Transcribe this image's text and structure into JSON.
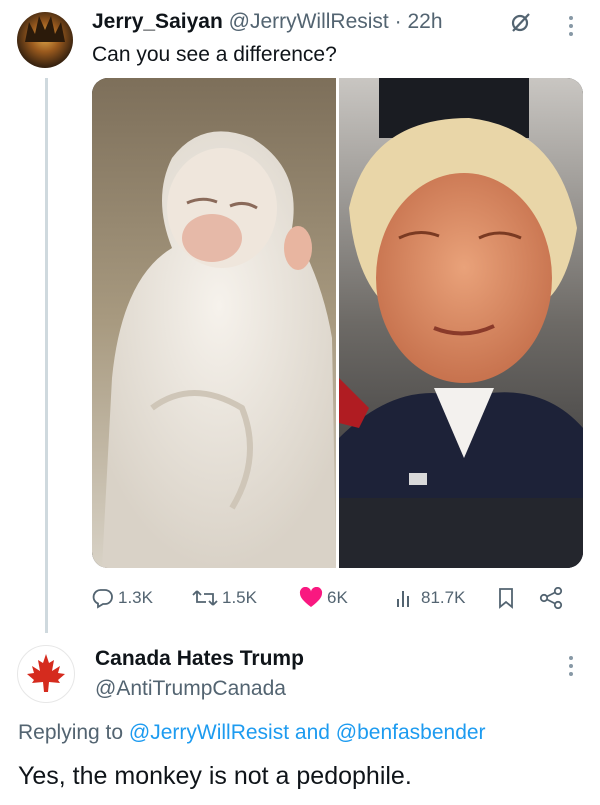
{
  "tweet": {
    "author_name": "Jerry_Saiyan",
    "author_handle": "@JerryWillResist",
    "separator": "·",
    "time": "22h",
    "text": "Can you see a difference?",
    "media": {
      "left_image": "white-monkey-eyes-closed-photo",
      "right_image": "man-in-suit-eyes-closed-photo"
    },
    "actions": {
      "replies": "1.3K",
      "reposts": "1.5K",
      "likes": "6K",
      "views": "81.7K"
    },
    "icons": [
      "grok-icon",
      "more-icon",
      "reply-icon",
      "repost-icon",
      "heart-icon",
      "views-icon",
      "bookmark-icon",
      "share-icon"
    ],
    "colors": {
      "like": "#f91880",
      "text": "#0f1419",
      "muted": "#536471",
      "link": "#1d9bf0"
    }
  },
  "reply": {
    "author_name": "Canada Hates Trump",
    "author_handle": "@AntiTrumpCanada",
    "replying_prefix": "Replying to",
    "replying_user1": "@JerryWillResist",
    "replying_and": "and",
    "replying_user2": "@benfasbender",
    "text": "Yes, the monkey is not a pedophile.",
    "avatar": "maple-leaf-icon",
    "avatar_color": "#d52b1e"
  }
}
